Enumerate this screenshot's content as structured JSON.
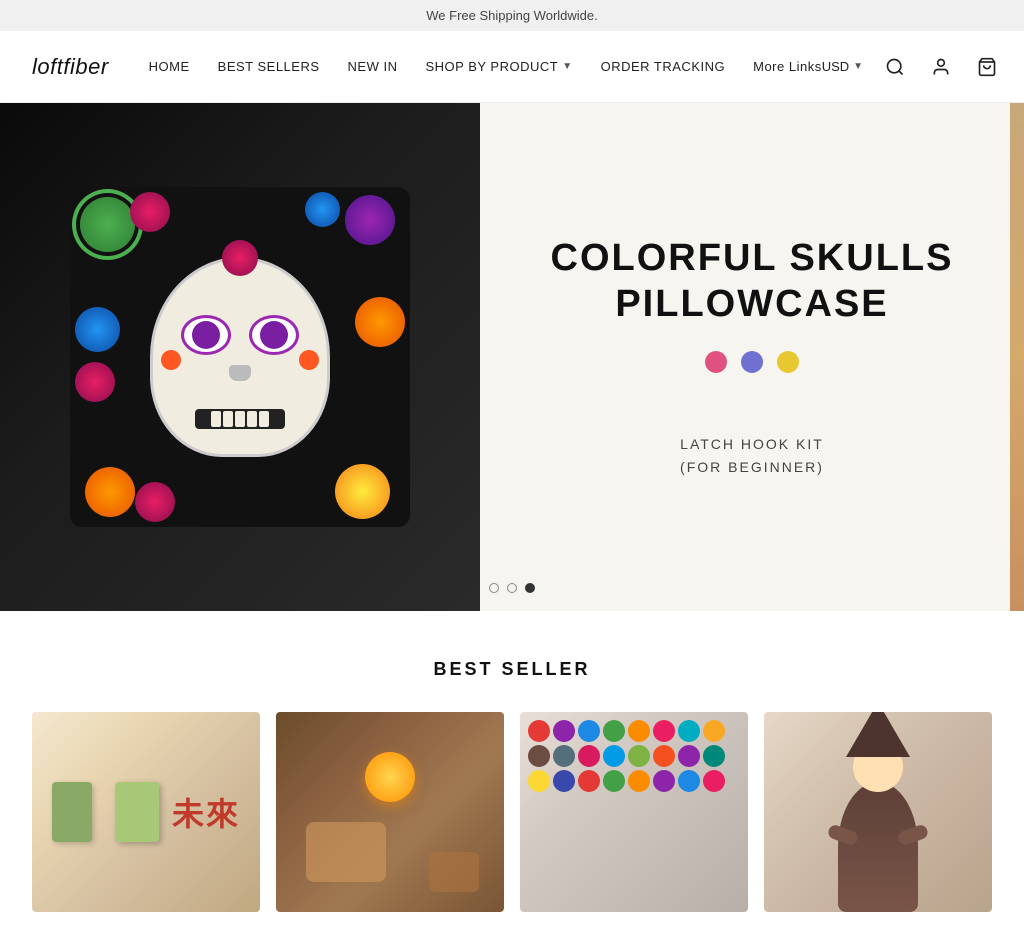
{
  "announcement": {
    "text": "We Free Shipping Worldwide."
  },
  "header": {
    "logo": "loftfiber",
    "nav": [
      {
        "label": "HOME",
        "dropdown": false,
        "id": "home"
      },
      {
        "label": "BEST SELLERS",
        "dropdown": false,
        "id": "best-sellers"
      },
      {
        "label": "NEW IN",
        "dropdown": false,
        "id": "new-in"
      },
      {
        "label": "SHOP BY PRODUCT",
        "dropdown": true,
        "id": "shop-by-product"
      },
      {
        "label": "ORDER TRACKING",
        "dropdown": false,
        "id": "order-tracking"
      },
      {
        "label": "More Links",
        "dropdown": false,
        "id": "more-links"
      }
    ],
    "currency": "USD",
    "actions": [
      "search",
      "account",
      "cart"
    ]
  },
  "hero": {
    "title_line1": "COLORFUL SKULLS",
    "title_line2": "PILLOWCASE",
    "subtitle_line1": "LATCH HOOK KIT",
    "subtitle_line2": "(FOR BEGINNER)",
    "color_dots": [
      "#e05080",
      "#7070d0",
      "#e8c830"
    ],
    "slide_count": 3,
    "current_slide": 2
  },
  "best_seller": {
    "section_title": "BEST SELLER",
    "products": [
      {
        "id": 1,
        "alt": "Japanese themed craft kit with red text"
      },
      {
        "id": 2,
        "alt": "Warm toned craft kit with candle"
      },
      {
        "id": 3,
        "alt": "Colorful stuffed animals collection"
      },
      {
        "id": 4,
        "alt": "Brown gnome or character doll"
      }
    ]
  }
}
